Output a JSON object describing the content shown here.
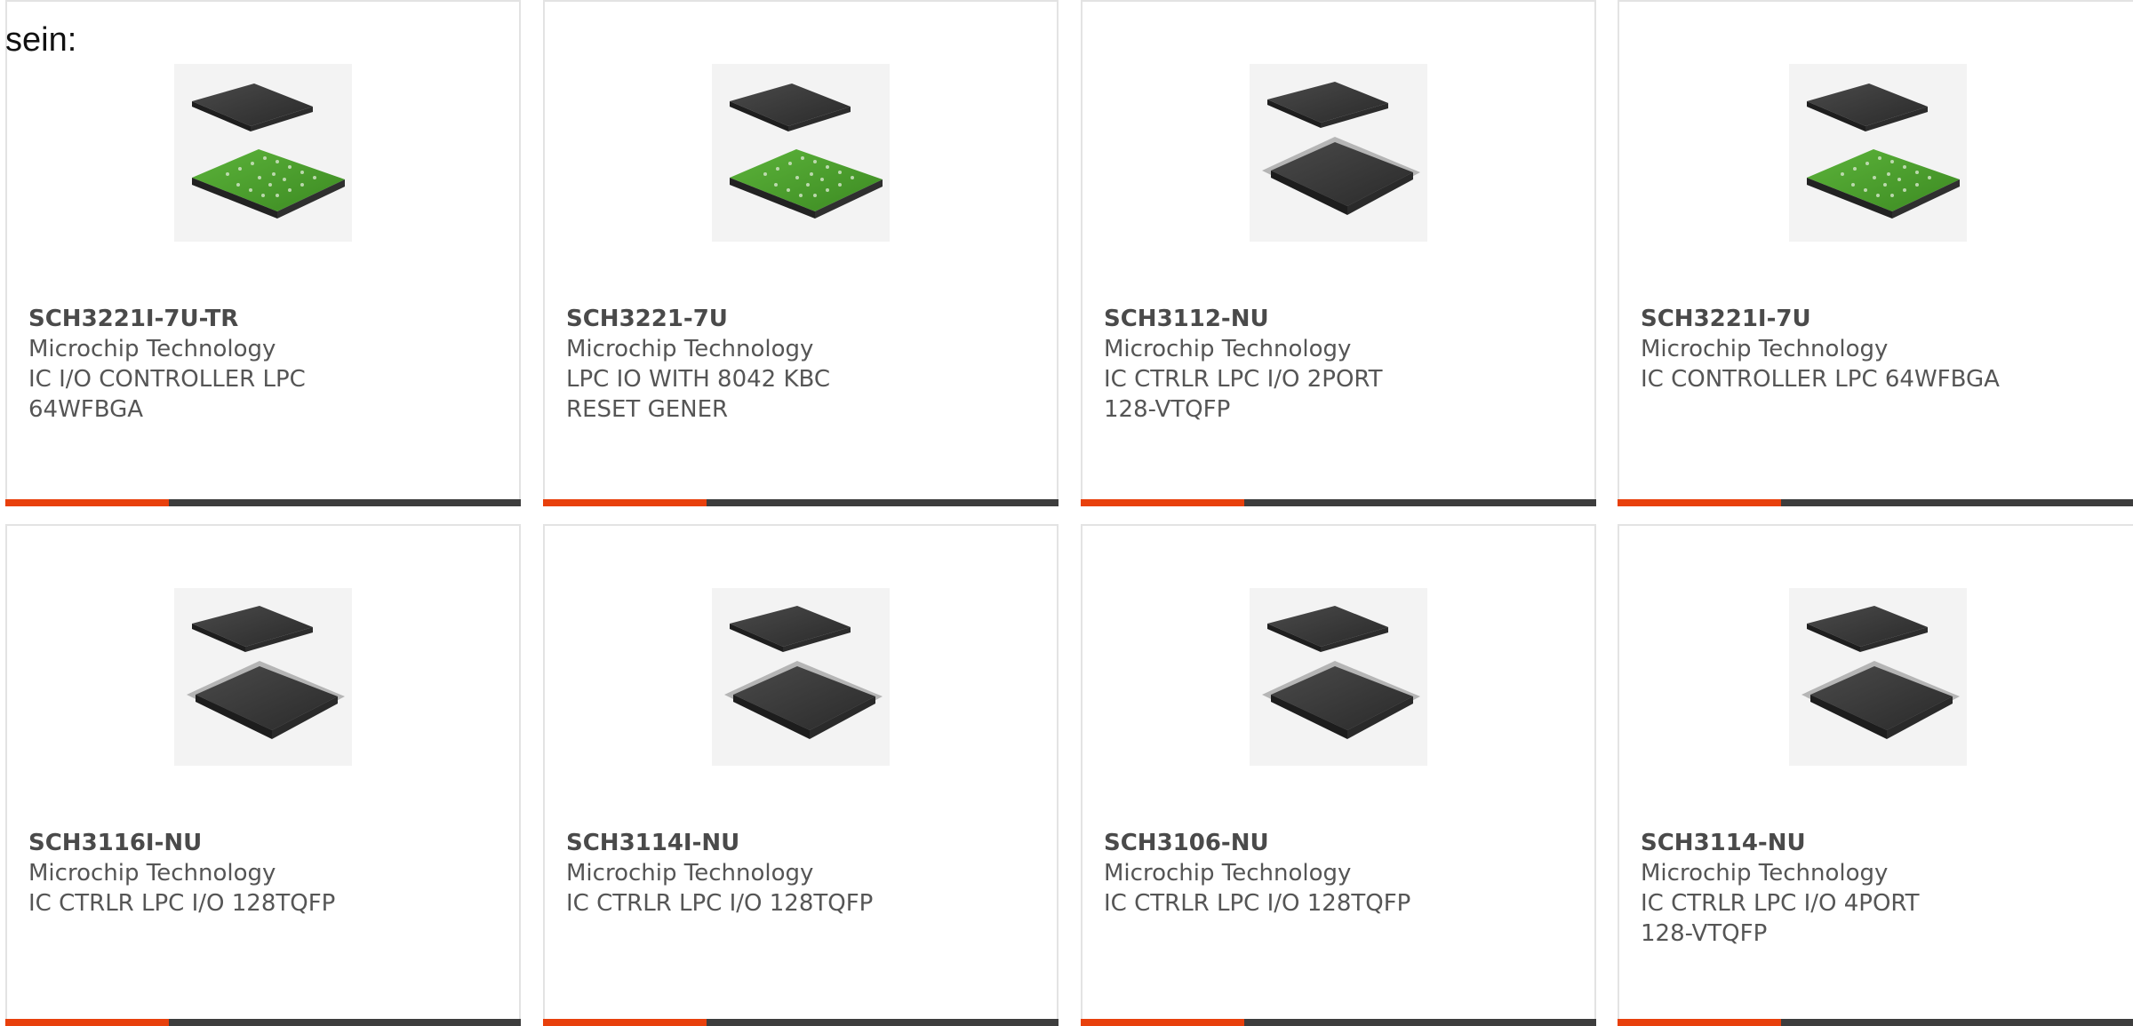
{
  "intro_text": "sein:",
  "colors": {
    "accent": "#e8400c",
    "bar_dark": "#3d3d3d",
    "pcb_green": "#4a9a2c",
    "chip_dark": "#333333"
  },
  "products": [
    {
      "part_number": "SCH3221I-7U-TR",
      "manufacturer": "Microchip Technology",
      "description": "IC I/O CONTROLLER LPC 64WFBGA",
      "image_icon": "bga-chip-icon"
    },
    {
      "part_number": "SCH3221-7U",
      "manufacturer": "Microchip Technology",
      "description": "LPC IO WITH 8042 KBC RESET GENER",
      "image_icon": "bga-chip-icon"
    },
    {
      "part_number": "SCH3112-NU",
      "manufacturer": "Microchip Technology",
      "description": "IC CTRLR LPC I/O 2PORT 128-VTQFP",
      "image_icon": "qfp-chip-icon"
    },
    {
      "part_number": "SCH3221I-7U",
      "manufacturer": "Microchip Technology",
      "description": "IC CONTROLLER LPC 64WFBGA",
      "image_icon": "bga-chip-icon"
    },
    {
      "part_number": "SCH3116I-NU",
      "manufacturer": "Microchip Technology",
      "description": "IC CTRLR LPC I/O 128TQFP",
      "image_icon": "qfp-chip-icon"
    },
    {
      "part_number": "SCH3114I-NU",
      "manufacturer": "Microchip Technology",
      "description": "IC CTRLR LPC I/O 128TQFP",
      "image_icon": "qfp-chip-icon"
    },
    {
      "part_number": "SCH3106-NU",
      "manufacturer": "Microchip Technology",
      "description": "IC CTRLR LPC I/O 128TQFP",
      "image_icon": "qfp-chip-icon"
    },
    {
      "part_number": "SCH3114-NU",
      "manufacturer": "Microchip Technology",
      "description": "IC CTRLR LPC I/O 4PORT 128-VTQFP",
      "image_icon": "qfp-chip-icon"
    }
  ]
}
